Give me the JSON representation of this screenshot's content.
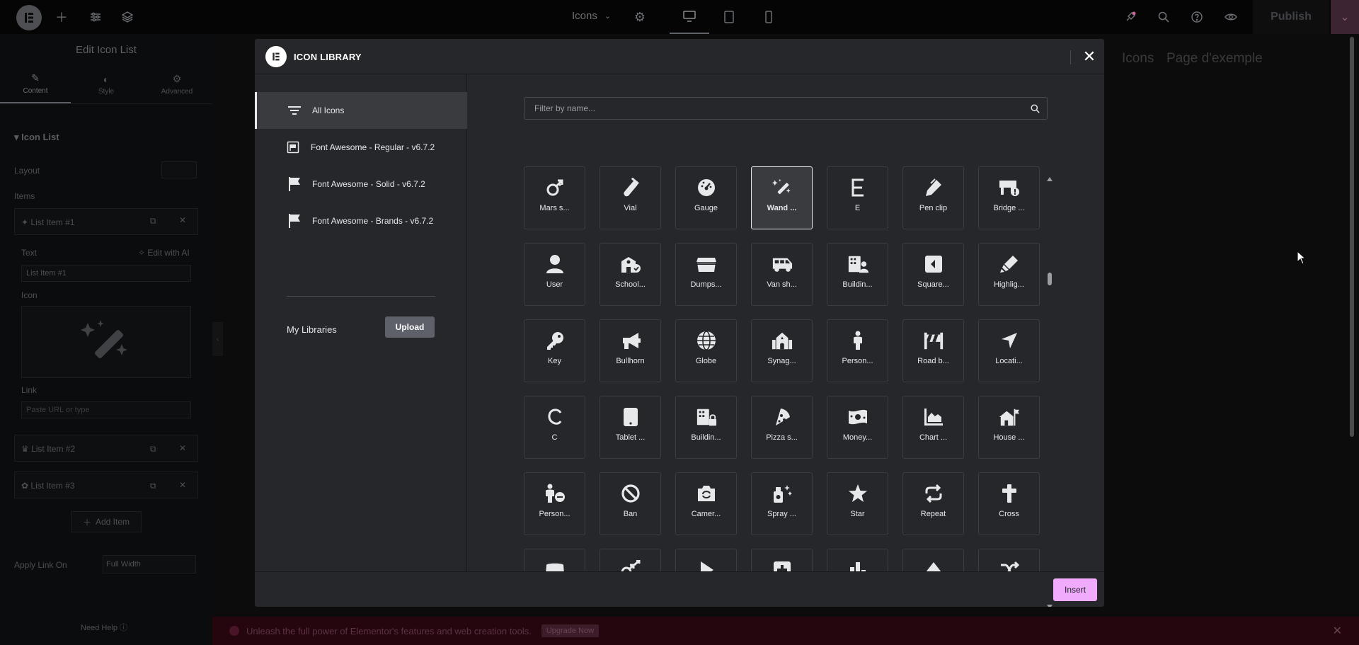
{
  "topbar": {
    "page_name": "Icons",
    "publish_label": "Publish"
  },
  "panel": {
    "title": "Edit Icon List",
    "tabs": [
      "Content",
      "Style",
      "Advanced"
    ],
    "section": "Icon List",
    "layout_label": "Layout",
    "items_label": "Items",
    "items": [
      "List Item #1",
      "List Item #2",
      "List Item #3"
    ],
    "text_label": "Text",
    "edit_ai": "Edit with AI",
    "text_value": "List Item #1",
    "icon_label": "Icon",
    "link_label": "Link",
    "link_placeholder": "Paste URL or type",
    "add_item": "Add Item",
    "apply_link_label": "Apply Link On",
    "apply_link_value": "Full Width",
    "help": "Need Help"
  },
  "canvas": {
    "links": [
      "Icons",
      "Page d'exemple"
    ],
    "promo_text": "Unleash the full power of Elementor's features and web creation tools.",
    "promo_button": "Upgrade Now"
  },
  "modal": {
    "title": "ICON LIBRARY",
    "libraries": [
      {
        "label": "All Icons",
        "icon": "filter-icon",
        "active": true
      },
      {
        "label": "Font Awesome - Regular - v6.7.2",
        "icon": "flag-regular-icon",
        "active": false
      },
      {
        "label": "Font Awesome - Solid - v6.7.2",
        "icon": "flag-solid-icon",
        "active": false
      },
      {
        "label": "Font Awesome - Brands - v6.7.2",
        "icon": "flag-brands-icon",
        "active": false
      }
    ],
    "my_libraries": "My Libraries",
    "upload_label": "Upload",
    "search_placeholder": "Filter by name...",
    "insert_label": "Insert",
    "icons": [
      {
        "label": "Mars s...",
        "icon": "mars-stroke-icon"
      },
      {
        "label": "Vial",
        "icon": "vial-icon"
      },
      {
        "label": "Gauge",
        "icon": "gauge-icon"
      },
      {
        "label": "Wand ...",
        "icon": "wand-magic-sparkles-icon",
        "selected": true
      },
      {
        "label": "E",
        "icon": "e-icon"
      },
      {
        "label": "Pen clip",
        "icon": "pen-clip-icon"
      },
      {
        "label": "Bridge ...",
        "icon": "bridge-circle-exclamation-icon"
      },
      {
        "label": "User",
        "icon": "user-icon"
      },
      {
        "label": "School...",
        "icon": "school-circle-check-icon"
      },
      {
        "label": "Dumps...",
        "icon": "dumpster-icon"
      },
      {
        "label": "Van sh...",
        "icon": "van-shuttle-icon"
      },
      {
        "label": "Buildin...",
        "icon": "building-user-icon"
      },
      {
        "label": "Square...",
        "icon": "square-caret-left-icon"
      },
      {
        "label": "Highlig...",
        "icon": "highlighter-icon"
      },
      {
        "label": "Key",
        "icon": "key-icon"
      },
      {
        "label": "Bullhorn",
        "icon": "bullhorn-icon"
      },
      {
        "label": "Globe",
        "icon": "globe-icon"
      },
      {
        "label": "Synag...",
        "icon": "synagogue-icon"
      },
      {
        "label": "Person...",
        "icon": "person-icon"
      },
      {
        "label": "Road b...",
        "icon": "road-barrier-icon"
      },
      {
        "label": "Locati...",
        "icon": "location-arrow-icon"
      },
      {
        "label": "C",
        "icon": "c-icon"
      },
      {
        "label": "Tablet ...",
        "icon": "tablet-button-icon"
      },
      {
        "label": "Buildin...",
        "icon": "building-lock-icon"
      },
      {
        "label": "Pizza s...",
        "icon": "pizza-slice-icon"
      },
      {
        "label": "Money...",
        "icon": "money-bill-icon"
      },
      {
        "label": "Chart ...",
        "icon": "chart-area-icon"
      },
      {
        "label": "House ...",
        "icon": "house-flag-icon"
      },
      {
        "label": "Person...",
        "icon": "person-circle-minus-icon"
      },
      {
        "label": "Ban",
        "icon": "ban-icon"
      },
      {
        "label": "Camer...",
        "icon": "camera-rotate-icon"
      },
      {
        "label": "Spray ...",
        "icon": "spray-can-sparkles-icon"
      },
      {
        "label": "Star",
        "icon": "star-icon"
      },
      {
        "label": "Repeat",
        "icon": "repeat-icon"
      },
      {
        "label": "Cross",
        "icon": "cross-icon"
      },
      {
        "label": "",
        "icon": "truck-icon"
      },
      {
        "label": "",
        "icon": "mars-double-icon"
      },
      {
        "label": "",
        "icon": "play-icon"
      },
      {
        "label": "",
        "icon": "square-plus-icon"
      },
      {
        "label": "",
        "icon": "chart-simple-icon"
      },
      {
        "label": "",
        "icon": "eject-icon"
      },
      {
        "label": "",
        "icon": "shuffle-icon"
      }
    ]
  }
}
